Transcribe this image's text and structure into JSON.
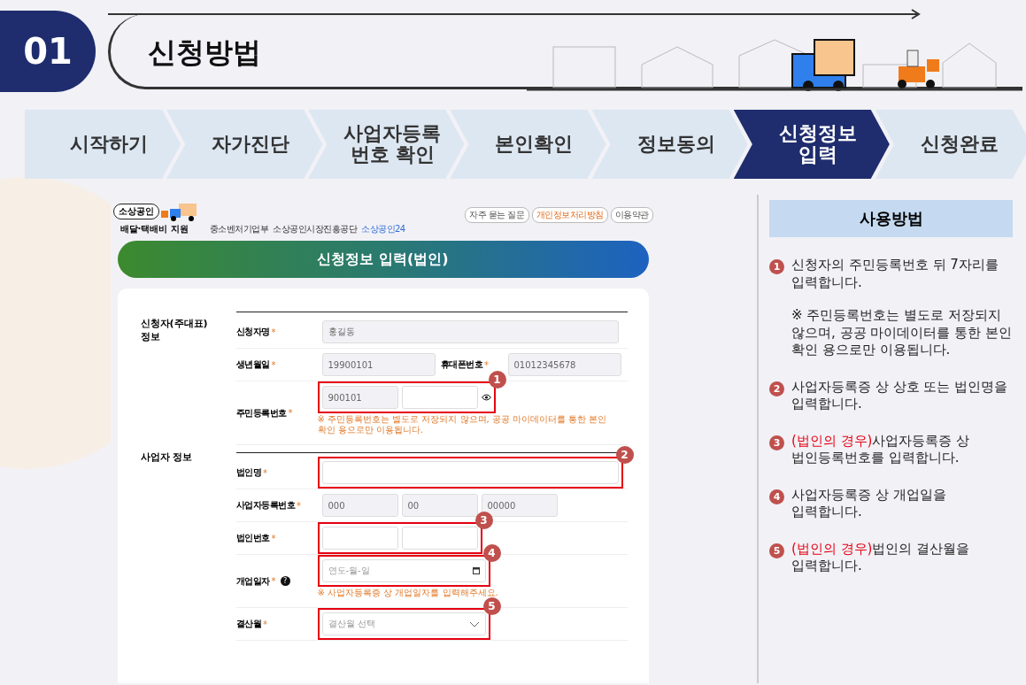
{
  "header": {
    "number": "01",
    "title": "신청방법"
  },
  "steps": [
    {
      "label": "시작하기",
      "selected": false
    },
    {
      "label": "자가진단",
      "selected": false
    },
    {
      "label": "사업자등록\n번호 확인",
      "selected": false
    },
    {
      "label": "본인확인",
      "selected": false
    },
    {
      "label": "정보동의",
      "selected": false
    },
    {
      "label": "신청정보\n입력",
      "selected": true
    },
    {
      "label": "신청완료",
      "selected": false
    }
  ],
  "site": {
    "logo_badge": "소상공인",
    "logo_text": "배달·택배비 지원",
    "agencies": [
      "중소벤처기업부",
      "소상공인시장진흥공단",
      "소상공인24"
    ],
    "top_links": [
      "자주 묻는 질문",
      "개인정보처리방침",
      "이용약관"
    ],
    "banner": "신청정보 입력(법인)",
    "sections": [
      {
        "title": "신청자(주대표)\n정보",
        "fields": [
          {
            "label": "신청자명",
            "mark": "*",
            "kind": "text",
            "boxes": [
              {
                "filled": true,
                "value": "홍길동"
              }
            ]
          },
          {
            "label": "생년월일",
            "mark": "*",
            "kind": "pair",
            "boxes": [
              {
                "filled": true,
                "value": "19900101"
              }
            ],
            "label2": "휴대폰번호",
            "mark2": "*",
            "value2": "01012345678"
          },
          {
            "label": "주민등록번호",
            "mark": "*",
            "kind": "rrn",
            "boxes": [
              {
                "filled": true,
                "value": "900101"
              },
              {
                "filled": false
              }
            ],
            "marker": "1",
            "hint": "※ 주민등록번호는 별도로 저장되지 않으며, 공공 마이데이터를 통한 본인 확인 용으로만 이용됩니다."
          }
        ]
      },
      {
        "title": "사업자 정보",
        "fields": [
          {
            "label": "법인명",
            "mark": "*",
            "kind": "text",
            "boxes": [
              {
                "filled": false
              }
            ],
            "marker": "2"
          },
          {
            "label": "사업자등록번호",
            "mark": "*",
            "kind": "split",
            "boxes": [
              {
                "filled": true,
                "value": "000"
              },
              {
                "filled": true,
                "value": "00"
              },
              {
                "filled": true,
                "value": "00000"
              }
            ]
          },
          {
            "label": "법인번호",
            "mark": "*",
            "kind": "split",
            "boxes": [
              {
                "filled": false
              },
              {
                "filled": false
              }
            ],
            "marker": "3"
          },
          {
            "label": "개업일자",
            "mark": "*",
            "kind": "date",
            "placeholder": "연도-월-일",
            "marker": "4",
            "help": "?",
            "hint": "※ 사업자등록증 상 개업일자를 입력해주세요."
          },
          {
            "label": "결산월",
            "mark": "*",
            "kind": "select",
            "placeholder": "결산월 선택",
            "marker": "5"
          }
        ]
      }
    ]
  },
  "guide": {
    "title": "사용방법",
    "items": [
      {
        "number": "1",
        "text": "신청자의 주민등록번호 뒤 7자리를 입력합니다.",
        "note": "※ 주민등록번호는 별도로 저장되지 않으며, 공공 마이데이터를 통한 본인 확인 용으로만 이용됩니다."
      },
      {
        "number": "2",
        "text": "사업자등록증 상 상호 또는 법인명을 입력합니다."
      },
      {
        "number": "3",
        "prefix": "(법인의 경우)",
        "text": "사업자등록증 상 법인등록번호를 입력합니다."
      },
      {
        "number": "4",
        "text": "사업자등록증 상 개업일을 입력합니다."
      },
      {
        "number": "5",
        "prefix": "(법인의 경우)",
        "text": "법인의 결산월을 입력합니다."
      }
    ]
  }
}
